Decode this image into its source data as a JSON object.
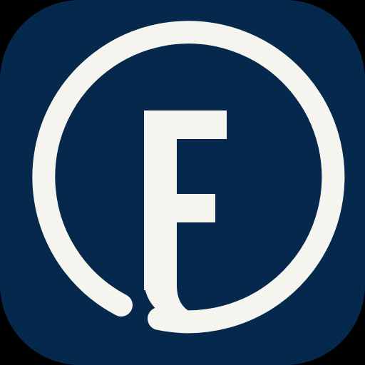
{
  "app_icon": {
    "letter": "E",
    "icon": "letter-e-in-open-circle-icon",
    "colors": {
      "page_background": "#000000",
      "tile_background": "#05284c",
      "foreground": "#f6f4ee"
    }
  }
}
